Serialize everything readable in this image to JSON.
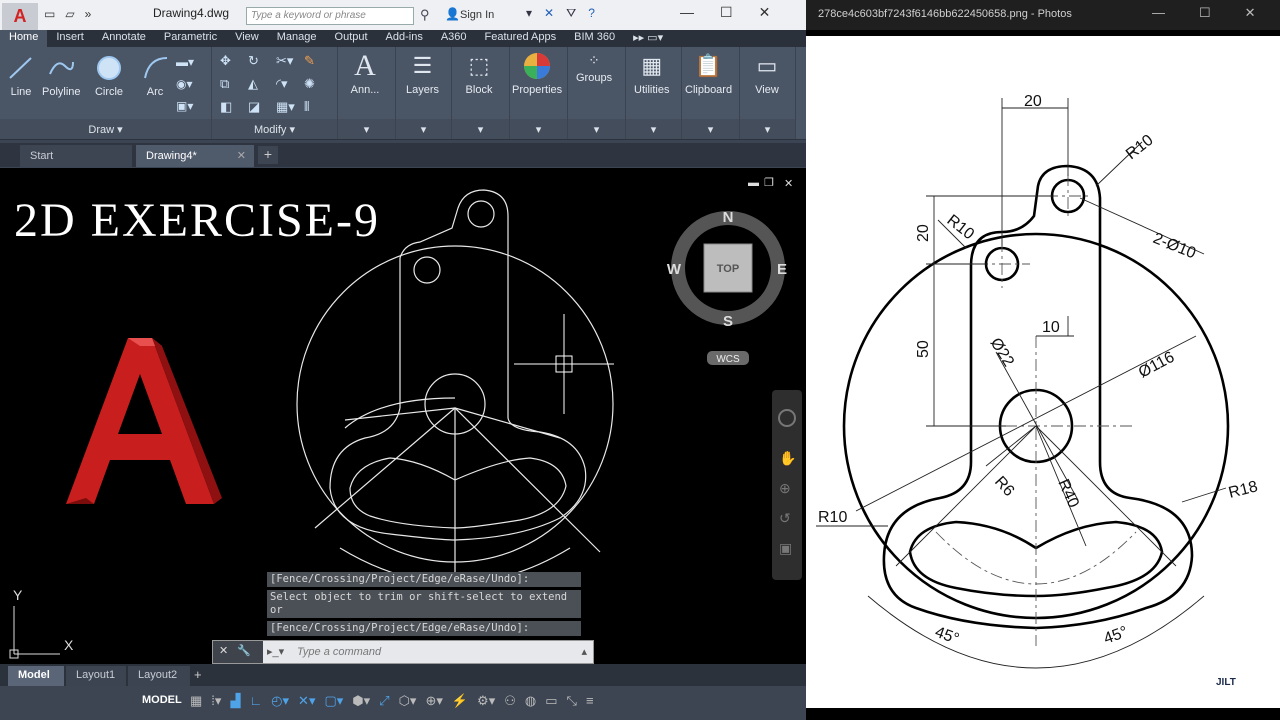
{
  "autocad": {
    "app_letter": "A",
    "doc_title": "Drawing4.dwg",
    "search_placeholder": "Type a keyword or phrase",
    "sign_in": "Sign In",
    "ribbon_tabs": [
      "Home",
      "Insert",
      "Annotate",
      "Parametric",
      "View",
      "Manage",
      "Output",
      "Add-ins",
      "A360",
      "Featured Apps",
      "BIM 360"
    ],
    "draw_tools": [
      "Line",
      "Polyline",
      "Circle",
      "Arc"
    ],
    "draw_panel": "Draw",
    "modify_panel": "Modify",
    "big_tools": [
      "Ann...",
      "Layers",
      "Block",
      "Properties",
      "Groups",
      "Utilities",
      "Clipboard",
      "View"
    ],
    "file_tabs": [
      "Start",
      "Drawing4*"
    ],
    "overlay_title": "2D EXERCISE-9",
    "viewcube": {
      "n": "N",
      "s": "S",
      "e": "E",
      "w": "W",
      "face": "TOP",
      "wcs": "WCS"
    },
    "ucs": {
      "x": "X",
      "y": "Y"
    },
    "command_history": [
      "[Fence/Crossing/Project/Edge/eRase/Undo]:",
      "Select object to trim or shift-select to extend or",
      "[Fence/Crossing/Project/Edge/eRase/Undo]:"
    ],
    "command_placeholder": "Type a command",
    "layout_tabs": [
      "Model",
      "Layout1",
      "Layout2"
    ],
    "status_model": "MODEL"
  },
  "photos": {
    "title": "278ce4c603bf7243f6146bb622450658.png - Photos",
    "watermark": "JILT",
    "dims": {
      "d20_top": "20",
      "r10_top": "R10",
      "r10_left": "R10",
      "two_phi10": "2-Ø10",
      "d20_left": "20",
      "d50": "50",
      "d10": "10",
      "phi22": "Ø22",
      "phi116": "Ø116",
      "r6": "R6",
      "r40": "R40",
      "r18": "R18",
      "r10_bottom": "R10",
      "ang_left": "45°",
      "ang_right": "45°"
    }
  }
}
